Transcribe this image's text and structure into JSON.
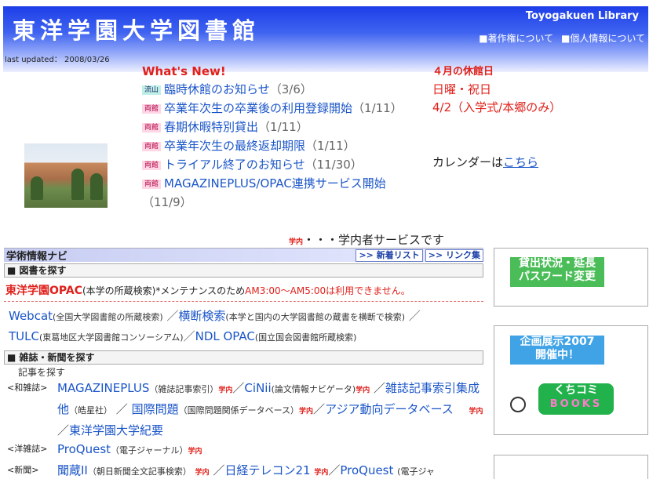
{
  "header": {
    "title": "東洋学園大学図書館",
    "english": "Toyogakuen Library",
    "links": [
      "■著作権について",
      "■個人情報について"
    ]
  },
  "last_updated": "last updated：  2008/03/26",
  "news": {
    "heading": "What's New!",
    "items": [
      {
        "tag": "流山",
        "tag_type": "nagareyama",
        "title": "臨時休館のお知らせ",
        "date": "（3/6）"
      },
      {
        "tag": "両館",
        "tag_type": "ryokan",
        "title": "卒業年次生の卒業後の利用登録開始",
        "date": "（1/11）"
      },
      {
        "tag": "両館",
        "tag_type": "ryokan",
        "title": "春期休暇特別貸出",
        "date": "（1/11）"
      },
      {
        "tag": "両館",
        "tag_type": "ryokan",
        "title": "卒業年次生の最終返却期限",
        "date": "（1/11）"
      },
      {
        "tag": "両館",
        "tag_type": "ryokan",
        "title": "トライアル終了のお知らせ",
        "date": "（11/30）"
      },
      {
        "tag": "両館",
        "tag_type": "ryokan",
        "title": "MAGAZINEPLUS/OPAC連携サービス開始",
        "date": "（11/9）"
      }
    ]
  },
  "closed_days": {
    "title": "４月の休館日",
    "line1": "日曜・祝日",
    "line2": "4/2（入学式/本郷のみ）"
  },
  "calendar": {
    "prefix": "カレンダーは",
    "link": "こちら"
  },
  "gakunai_note": {
    "badge": "学内",
    "text": "・・・学内者サービスです"
  },
  "navi": {
    "label": "学術情報ナビ",
    "new_list": ">> 新着リスト",
    "link_list": ">> リンク集",
    "section_books": "■ 図書を探す",
    "opac_name": "東洋学園OPAC",
    "opac_desc": "(本学の所蔵検索)*メンテナンスのため",
    "opac_warn": "AM3:00〜AM5:00は利用できません。",
    "webcat": "Webcat",
    "webcat_desc": "(全国大学図書館の所蔵検索)",
    "yokodan": "横断検索",
    "yokodan_desc": "(本学と国内の大学図書館の蔵書を横断で検索)",
    "tulc": "TULC",
    "tulc_desc": "(東葛地区大学図書館コンソーシアム)",
    "ndl": "NDL OPAC",
    "ndl_desc": "(国立国会図書館所蔵検索)",
    "section_journals": "■ 雑誌・新聞を探す",
    "kiji": "記事を探す",
    "wa_label": "<和雑誌>",
    "magazineplus": "MAGAZINEPLUS",
    "magazineplus_desc": "（雑誌記事索引）",
    "cinii": "CiNii",
    "cinii_desc": "(論文情報ナビゲータ)",
    "zasshi_kiji": "雑誌記事索引集成他",
    "zasshi_kiji_desc": "（皓星社）",
    "kokusai": "国際問題",
    "kokusai_desc": "（国際問題関係データベース）",
    "asia": "アジア動向データベース",
    "kiyo": "東洋学園大学紀要",
    "yo_label": "<洋雑誌>",
    "proquest": "ProQuest",
    "proquest_desc": "（電子ジャーナル）",
    "news_label": "<新聞>",
    "kikuzo": "聞蔵II",
    "kikuzo_desc": "（朝日新聞全文記事検索）",
    "nikkei": "日経テレコン21",
    "proquest2": "ProQuest",
    "proquest2_desc": "(電子ジャ",
    "badge": "学内"
  },
  "side": {
    "loan_l1": "貸出状況・延長",
    "loan_l2": "パスワード変更",
    "exhibit_l1": "企画展示2007",
    "exhibit_l2": "開催中！",
    "kuchi_l1": "くちコミ",
    "kuchi_l2": "BOOKS"
  },
  "colors": {
    "header_blue": "#1d3ee8",
    "link": "#1a55c8",
    "red": "#e0201a",
    "green": "#22b24c"
  }
}
